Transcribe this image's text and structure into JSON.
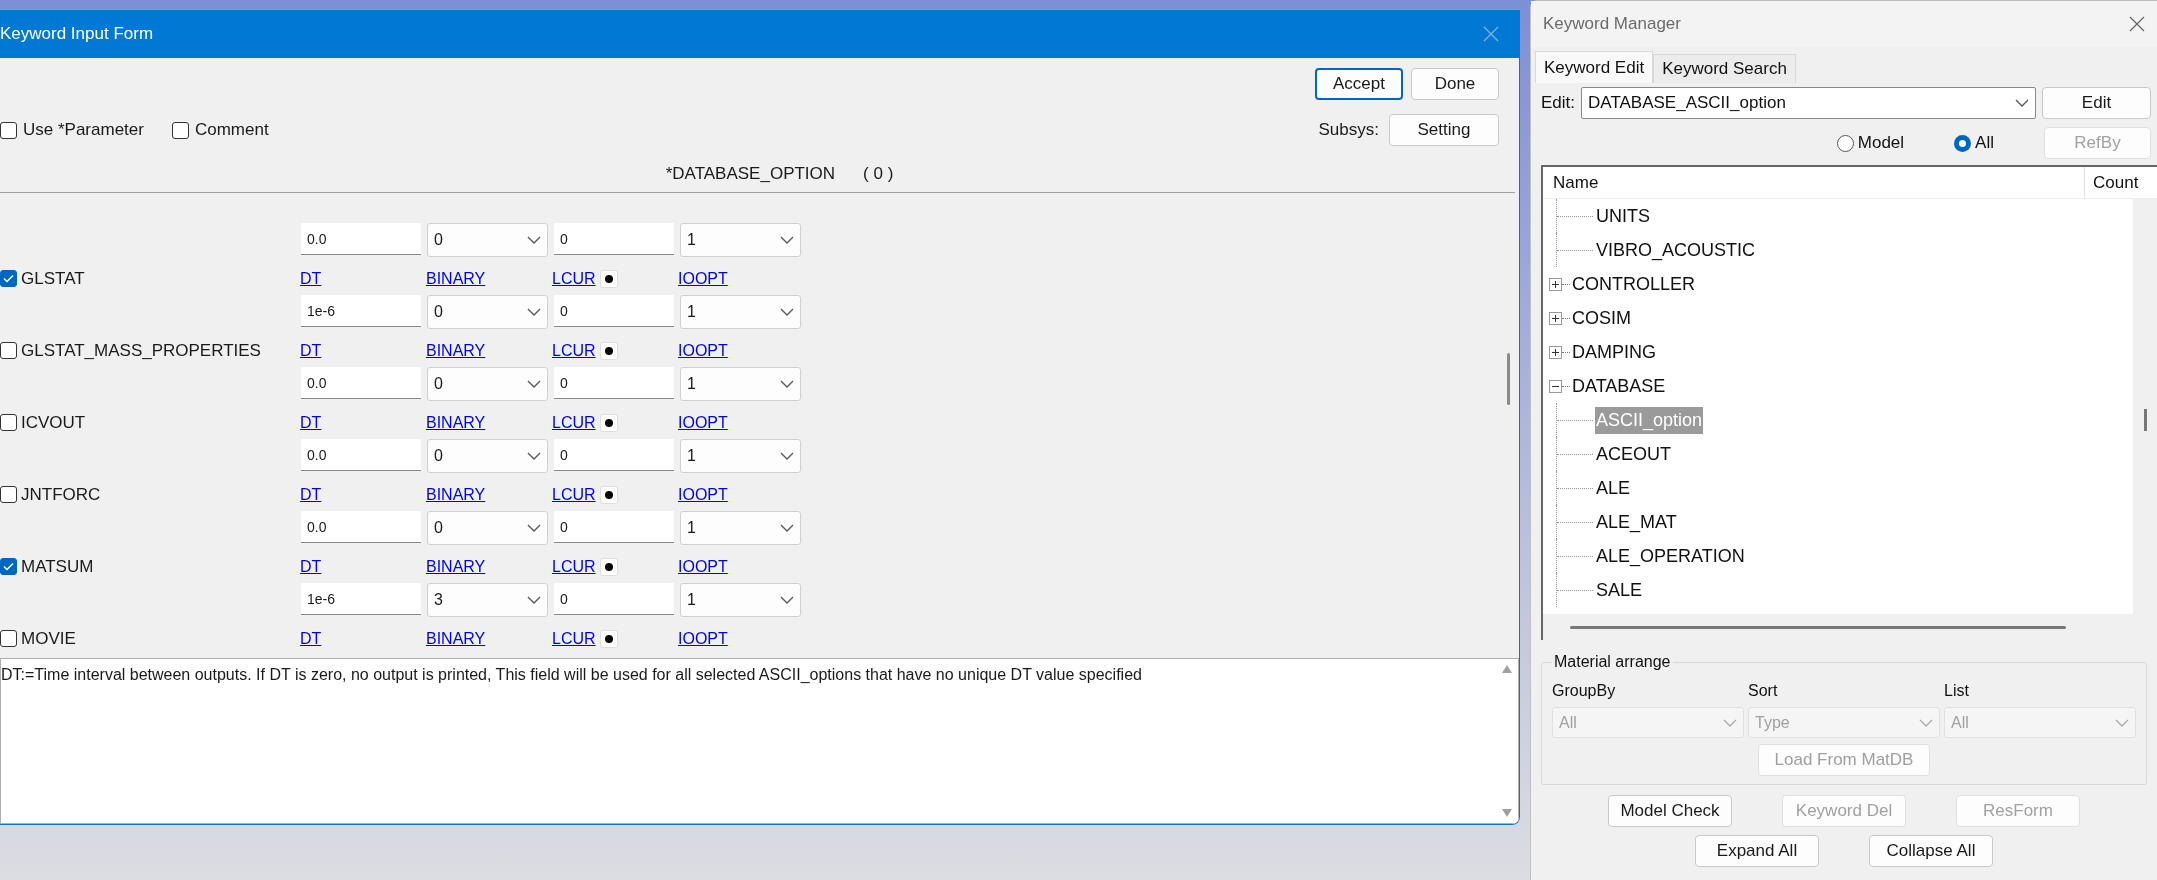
{
  "keyword_input_form": {
    "title": "Keyword Input Form",
    "buttons": [
      {
        "label": "Accept",
        "focused": true
      },
      {
        "label": "Done",
        "focused": false
      }
    ],
    "checkboxes": [
      {
        "label": "Use *Parameter",
        "checked": false
      },
      {
        "label": "Comment",
        "checked": false
      }
    ],
    "subsys_label": "Subsys:",
    "setting_button": "Setting",
    "keyword_title": "*DATABASE_OPTION",
    "keyword_count": "( 0 )",
    "options": [
      {
        "values": [
          "0.0",
          "0",
          "0",
          "1"
        ]
      },
      {
        "name": "GLSTAT",
        "checked": true,
        "links": [
          "DT",
          "BINARY",
          "LCUR",
          "IOOPT"
        ],
        "values": [
          "1e-6",
          "0",
          "0",
          "1"
        ]
      },
      {
        "name": "GLSTAT_MASS_PROPERTIES",
        "checked": false,
        "links": [
          "DT",
          "BINARY",
          "LCUR",
          "IOOPT"
        ],
        "values": [
          "0.0",
          "0",
          "0",
          "1"
        ]
      },
      {
        "name": "ICVOUT",
        "checked": false,
        "links": [
          "DT",
          "BINARY",
          "LCUR",
          "IOOPT"
        ],
        "values": [
          "0.0",
          "0",
          "0",
          "1"
        ]
      },
      {
        "name": "JNTFORC",
        "checked": false,
        "links": [
          "DT",
          "BINARY",
          "LCUR",
          "IOOPT"
        ],
        "values": [
          "0.0",
          "0",
          "0",
          "1"
        ]
      },
      {
        "name": "MATSUM",
        "checked": true,
        "links": [
          "DT",
          "BINARY",
          "LCUR",
          "IOOPT"
        ],
        "values": [
          "1e-6",
          "3",
          "0",
          "1"
        ]
      },
      {
        "name": "MOVIE",
        "checked": false,
        "links": [
          "DT",
          "BINARY",
          "LCUR",
          "IOOPT"
        ]
      }
    ],
    "help_text": "DT:=Time interval between outputs. If DT is zero, no output is printed, This field will be used for all selected ASCII_options that have no unique DT value specified"
  },
  "keyword_manager": {
    "title": "Keyword Manager",
    "tabs": [
      {
        "label": "Keyword Edit",
        "selected": true
      },
      {
        "label": "Keyword Search",
        "selected": false
      }
    ],
    "edit_label": "Edit:",
    "edit_value": "DATABASE_ASCII_option",
    "edit_button": "Edit",
    "radios": [
      {
        "label": "Model",
        "selected": false
      },
      {
        "label": "All",
        "selected": true
      }
    ],
    "refby_button": {
      "label": "RefBy",
      "disabled": true
    },
    "tree": {
      "columns": [
        "Name",
        "Count"
      ],
      "items": [
        {
          "children": [
            {
              "label": "UNITS",
              "selected": false
            },
            {
              "label": "VIBRO_ACOUSTIC",
              "selected": false
            }
          ]
        },
        {
          "label": "CONTROLLER",
          "expanded": false,
          "selected": false
        },
        {
          "label": "COSIM",
          "expanded": false,
          "selected": false
        },
        {
          "label": "DAMPING",
          "expanded": false,
          "selected": false
        },
        {
          "label": "DATABASE",
          "expanded": true,
          "selected": false,
          "children": [
            {
              "label": "ASCII_option",
              "selected": true
            },
            {
              "label": "ACEOUT",
              "selected": false
            },
            {
              "label": "ALE",
              "selected": false
            },
            {
              "label": "ALE_MAT",
              "selected": false
            },
            {
              "label": "ALE_OPERATION",
              "selected": false
            },
            {
              "label": "SALE",
              "selected": false
            }
          ]
        }
      ]
    },
    "material_arrange": {
      "title": "Material arrange",
      "filters": [
        {
          "label": "GroupBy",
          "value": "All",
          "disabled": true
        },
        {
          "label": "Sort",
          "value": "Type",
          "disabled": true
        },
        {
          "label": "List",
          "value": "All",
          "disabled": true
        }
      ],
      "load_button": {
        "label": "Load From MatDB",
        "disabled": true
      }
    },
    "button_rows": [
      [
        {
          "label": "Model Check",
          "disabled": false
        },
        {
          "label": "Keyword Del",
          "disabled": true
        },
        {
          "label": "ResForm",
          "disabled": true
        }
      ],
      [
        {
          "label": "Expand All",
          "disabled": false
        },
        {
          "label": "Collapse All",
          "disabled": false
        }
      ]
    ]
  }
}
